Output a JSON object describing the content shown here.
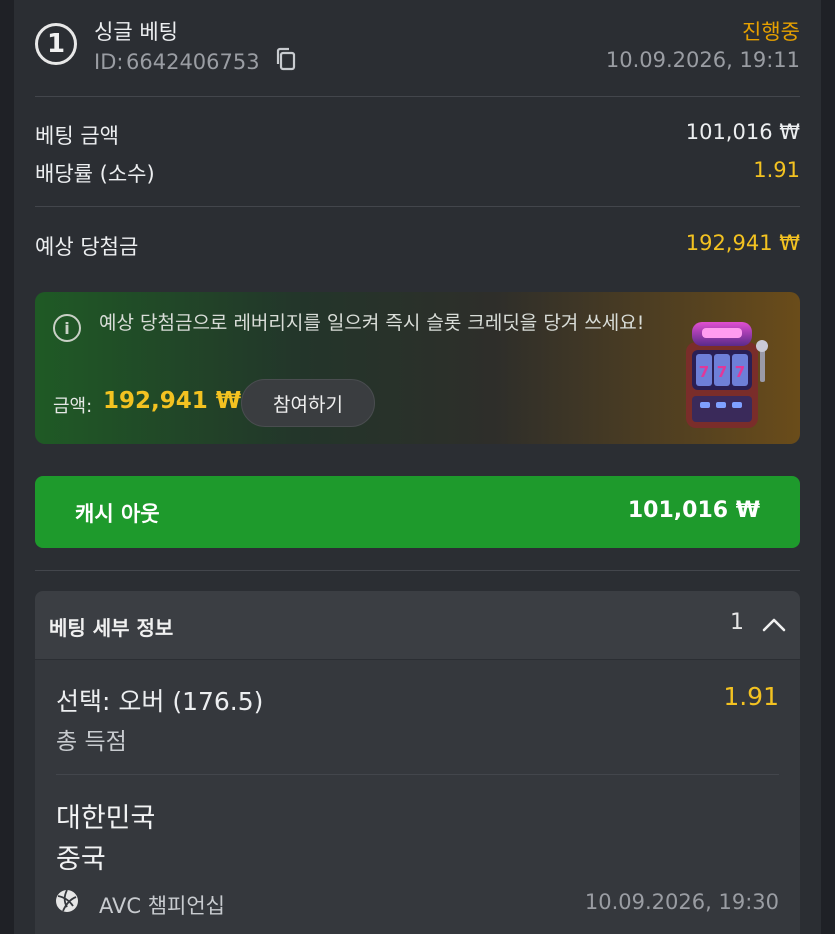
{
  "bet_header": {
    "number": "1",
    "type": "싱글 베팅",
    "id_label": "ID:",
    "id_value": "6642406753",
    "status": "진행중",
    "datetime": "10.09.2026, 19:11"
  },
  "summary": {
    "stake_label": "베팅 금액",
    "stake_value": "101,016 ₩",
    "odds_label": "배당률 (소수)",
    "odds_value": "1.91",
    "potential_label": "예상 당첨금",
    "potential_value": "192,941 ₩"
  },
  "promo": {
    "text": "예상 당첨금으로 레버리지를 일으켜 즉시 슬롯 크레딧을 당겨 쓰세요!",
    "amount_label": "금액:",
    "amount_value": "192,941 ₩",
    "join_label": "참여하기"
  },
  "cashout": {
    "label": "캐시 아웃",
    "value": "101,016 ₩"
  },
  "details": {
    "title": "베팅 세부 정보",
    "count": "1",
    "selection": "선택: 오버 (176.5)",
    "selection_odds": "1.91",
    "market": "총 득점",
    "team_home": "대한민국",
    "team_away": "중국",
    "league": "AVC 챔피언십",
    "match_datetime": "10.09.2026, 19:30"
  },
  "colors": {
    "accent_gold": "#f3c221",
    "status_orange": "#e6a000",
    "cashout_green": "#1e9a2c"
  },
  "icons": [
    "copy-icon",
    "info-icon",
    "slot-machine-icon",
    "chevron-up-icon",
    "volleyball-icon"
  ]
}
